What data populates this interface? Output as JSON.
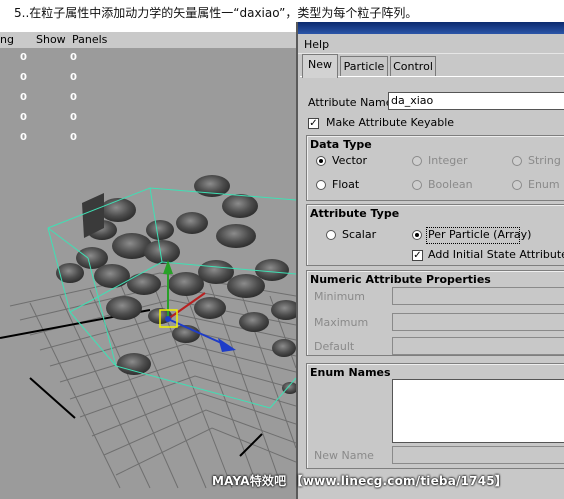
{
  "caption": "5..在粒子属性中添加动力学的矢量属性一“daxiao”，类型为每个粒子阵列。",
  "viewport": {
    "menu": [
      "ng",
      "Show",
      "Panels"
    ],
    "stats": [
      [
        "0",
        "0"
      ],
      [
        "0",
        "0"
      ],
      [
        "0",
        "0"
      ],
      [
        "0",
        "0"
      ],
      [
        "0",
        "0"
      ]
    ]
  },
  "dialog": {
    "menu_help": "Help",
    "tabs": [
      "New",
      "Particle",
      "Control"
    ],
    "active_tab": "New",
    "attribute_name_label": "Attribute Name",
    "attribute_name_value": "da_xiao",
    "make_keyable_label": "Make Attribute Keyable",
    "make_keyable_checked": true,
    "data_type": {
      "title": "Data Type",
      "options": [
        "Vector",
        "Integer",
        "String",
        "Float",
        "Boolean",
        "Enum"
      ],
      "selected": "Vector"
    },
    "attribute_type": {
      "title": "Attribute Type",
      "scalar": "Scalar",
      "per_particle": "Per Particle (Array)",
      "selected": "Per Particle (Array)",
      "add_initial_state": "Add Initial State Attribute",
      "add_initial_state_checked": true
    },
    "numeric": {
      "title": "Numeric Attribute Properties",
      "minimum": "Minimum",
      "maximum": "Maximum",
      "default": "Default"
    },
    "enum": {
      "title": "Enum Names",
      "new_name": "New Name"
    }
  },
  "watermark": "MAYA特效吧 【www.linecg.com/tieba/1745】",
  "colors": {
    "viewport_bg": "#9b9b9b",
    "panel_bg": "#c8c8c8",
    "bounding_box": "#3fe0b4",
    "selection": "#f2f200",
    "manipulator_blue": "#1e3cc8",
    "manipulator_green": "#28a028"
  }
}
